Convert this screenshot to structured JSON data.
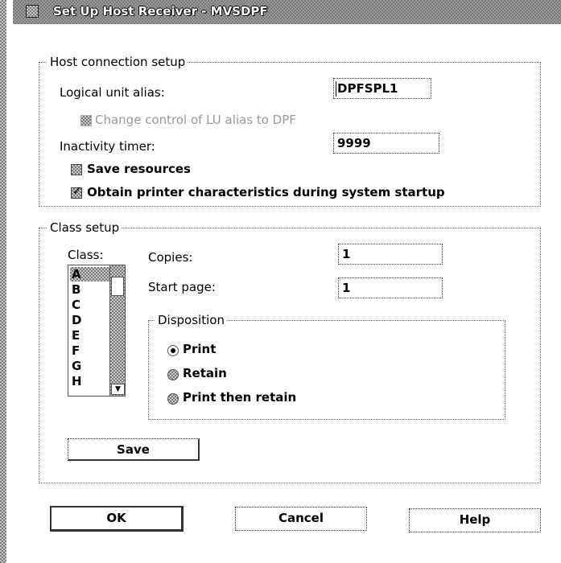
{
  "window": {
    "title": "Set Up Host Receiver - MVSDPF"
  },
  "host_connection": {
    "legend": "Host connection setup",
    "logical_unit_alias_label": "Logical unit alias:",
    "logical_unit_alias_value": "DPFSPL1",
    "change_control_label": "Change control of LU alias to DPF",
    "change_control_checked": false,
    "change_control_enabled": false,
    "inactivity_timer_label": "Inactivity timer:",
    "inactivity_timer_value": "9999",
    "save_resources_label": "Save resources",
    "save_resources_checked": false,
    "obtain_printer_label": "Obtain printer characteristics during system startup",
    "obtain_printer_checked": true
  },
  "class_setup": {
    "legend": "Class setup",
    "class_label": "Class:",
    "classes": [
      "A",
      "B",
      "C",
      "D",
      "E",
      "F",
      "G",
      "H"
    ],
    "selected_class": "A",
    "copies_label": "Copies:",
    "copies_value": "1",
    "start_page_label": "Start page:",
    "start_page_value": "1",
    "disposition": {
      "legend": "Disposition",
      "options": [
        "Print",
        "Retain",
        "Print then retain"
      ],
      "selected": "Print"
    },
    "save_button": "Save"
  },
  "buttons": {
    "ok": "OK",
    "cancel": "Cancel",
    "help": "Help"
  }
}
